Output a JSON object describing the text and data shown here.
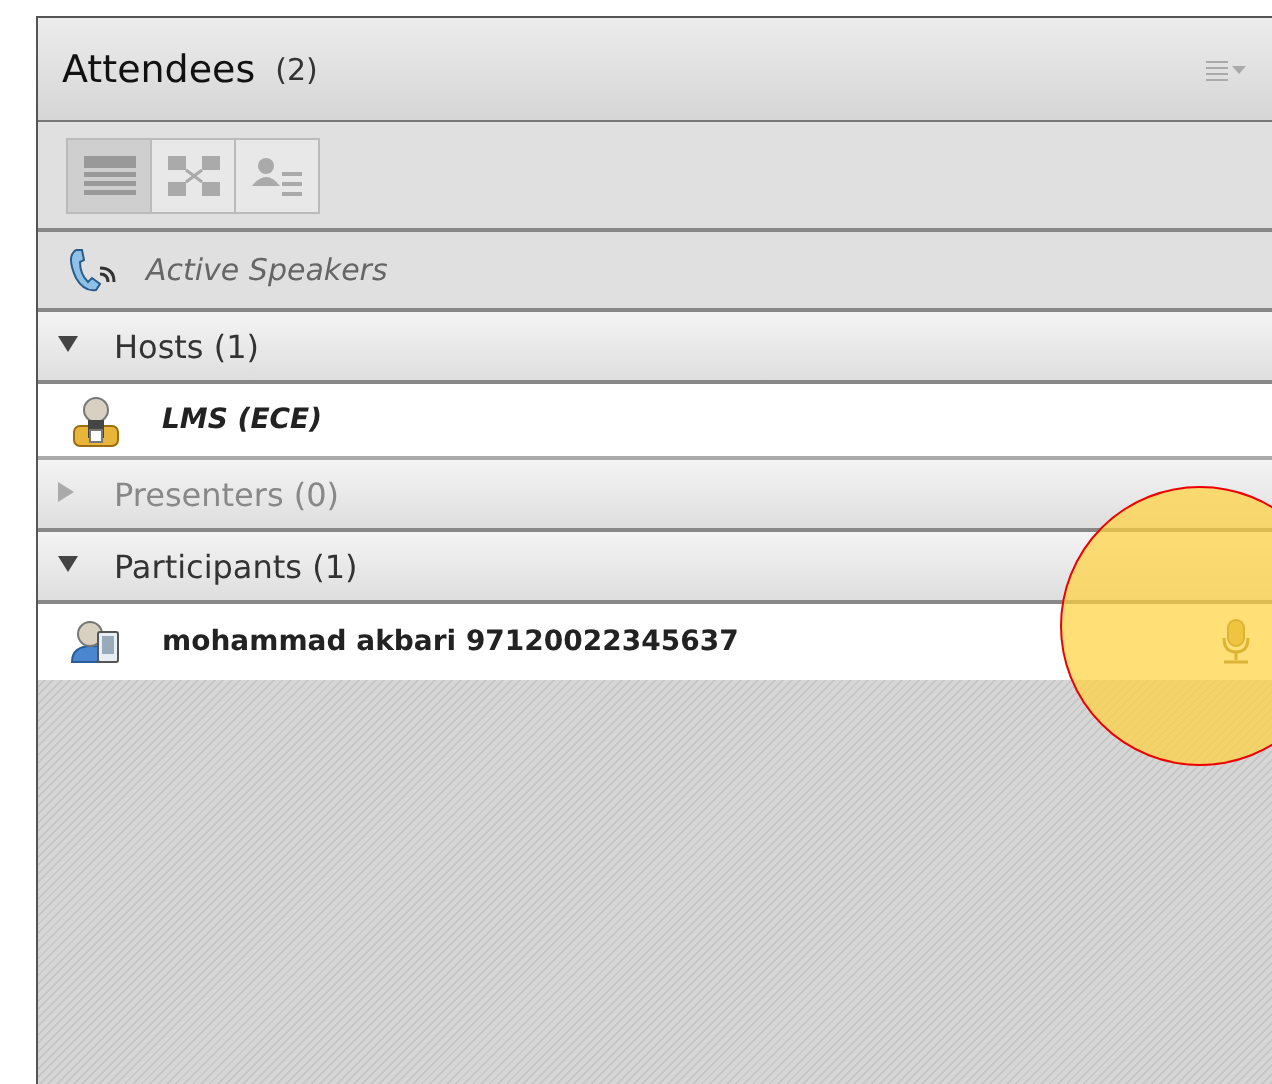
{
  "panel": {
    "title": "Attendees",
    "count": "(2)"
  },
  "view_buttons": [
    {
      "kind": "list",
      "selected": true
    },
    {
      "kind": "grid",
      "selected": false
    },
    {
      "kind": "details",
      "selected": false
    }
  ],
  "active_speakers": {
    "label": "Active Speakers"
  },
  "groups": [
    {
      "label": "Hosts (1)",
      "expanded": true,
      "disabled": false,
      "members": [
        {
          "name": "LMS (ECE)",
          "kind": "host",
          "italic": true,
          "mic": false
        }
      ]
    },
    {
      "label": "Presenters (0)",
      "expanded": false,
      "disabled": true
    },
    {
      "label": "Participants (1)",
      "expanded": true,
      "disabled": false,
      "members": [
        {
          "name": "mohammad akbari 97120022345637",
          "kind": "participant",
          "italic": false,
          "mic": true
        }
      ]
    }
  ],
  "highlight": {
    "on": true
  }
}
